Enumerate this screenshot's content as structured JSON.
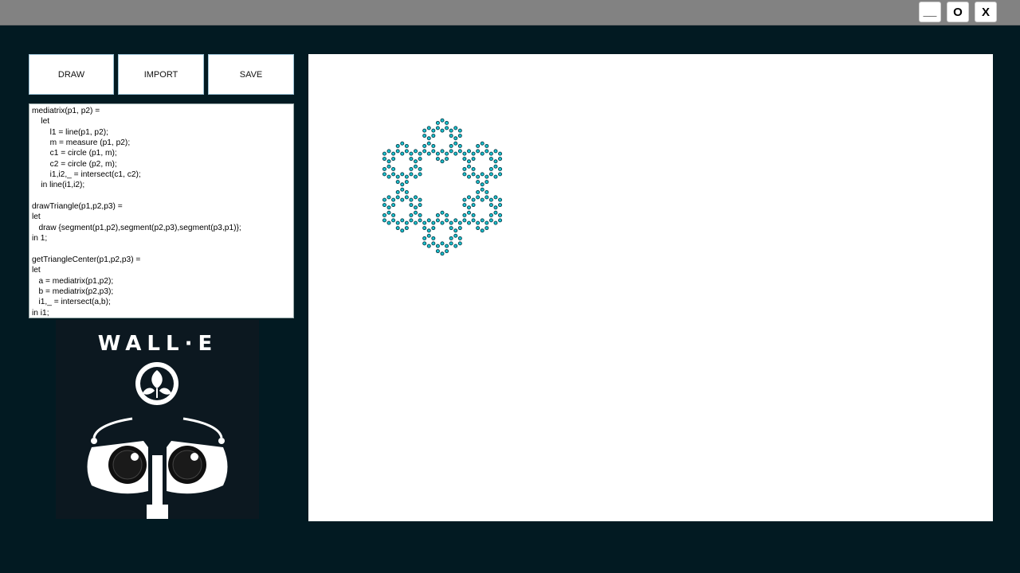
{
  "window": {
    "minimize_label": "__",
    "maximize_label": "O",
    "close_label": "X"
  },
  "toolbar": {
    "draw_label": "DRAW",
    "import_label": "IMPORT",
    "save_label": "SAVE"
  },
  "editor": {
    "code": "mediatrix(p1, p2) =\n    let\n        l1 = line(p1, p2);\n        m = measure (p1, p2);\n        c1 = circle (p1, m);\n        c2 = circle (p2, m);\n        i1,i2,_ = intersect(c1, c2);\n    in line(i1,i2);\n\ndrawTriangle(p1,p2,p3) =\nlet\n   draw {segment(p1,p2),segment(p2,p3),segment(p3,p1)};\nin 1;\n\ngetTriangleCenter(p1,p2,p3) =\nlet\n   a = mediatrix(p1,p2);\n   b = mediatrix(p2,p3);\n   i1,_ = intersect(a,b);\nin i1;"
  },
  "logo": {
    "text": "WALL·E",
    "icon": "wall-e-logo-icon"
  },
  "colors": {
    "background": "#021a22",
    "titlebar": "#828282",
    "fractal_fill": "#19c3cf",
    "fractal_dark": "#0b3d4a"
  }
}
